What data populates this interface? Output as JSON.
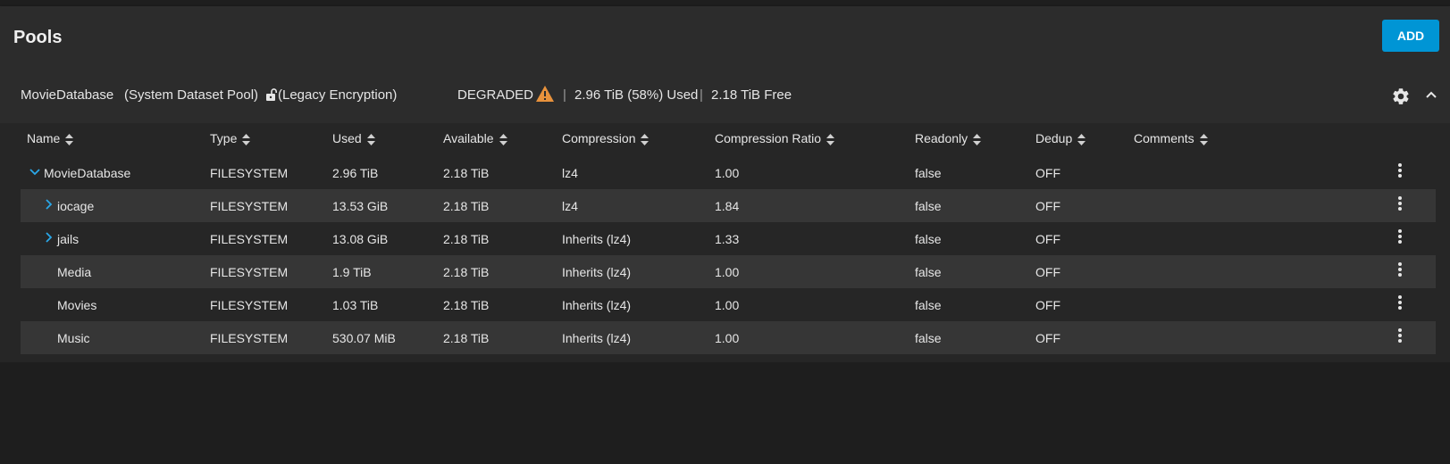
{
  "page": {
    "title": "Pools",
    "add_label": "ADD"
  },
  "pool": {
    "name": "MovieDatabase",
    "system_tag": "(System Dataset Pool)",
    "encryption": "(Legacy Encryption)",
    "status": "DEGRADED",
    "sep1": "|",
    "used": "2.96 TiB (58%) Used",
    "sep2": "|",
    "free": "2.18 TiB Free"
  },
  "columns": [
    "Name",
    "Type",
    "Used",
    "Available",
    "Compression",
    "Compression Ratio",
    "Readonly",
    "Dedup",
    "Comments"
  ],
  "rows": [
    {
      "name": "MovieDatabase",
      "type": "FILESYSTEM",
      "used": "2.96 TiB",
      "available": "2.18 TiB",
      "compression": "lz4",
      "ratio": "1.00",
      "readonly": "false",
      "dedup": "OFF",
      "comments": ""
    },
    {
      "name": "iocage",
      "type": "FILESYSTEM",
      "used": "13.53 GiB",
      "available": "2.18 TiB",
      "compression": "lz4",
      "ratio": "1.84",
      "readonly": "false",
      "dedup": "OFF",
      "comments": ""
    },
    {
      "name": "jails",
      "type": "FILESYSTEM",
      "used": "13.08 GiB",
      "available": "2.18 TiB",
      "compression": "Inherits (lz4)",
      "ratio": "1.33",
      "readonly": "false",
      "dedup": "OFF",
      "comments": ""
    },
    {
      "name": "Media",
      "type": "FILESYSTEM",
      "used": "1.9 TiB",
      "available": "2.18 TiB",
      "compression": "Inherits (lz4)",
      "ratio": "1.00",
      "readonly": "false",
      "dedup": "OFF",
      "comments": ""
    },
    {
      "name": "Movies",
      "type": "FILESYSTEM",
      "used": "1.03 TiB",
      "available": "2.18 TiB",
      "compression": "Inherits (lz4)",
      "ratio": "1.00",
      "readonly": "false",
      "dedup": "OFF",
      "comments": ""
    },
    {
      "name": "Music",
      "type": "FILESYSTEM",
      "used": "530.07 MiB",
      "available": "2.18 TiB",
      "compression": "Inherits (lz4)",
      "ratio": "1.00",
      "readonly": "false",
      "dedup": "OFF",
      "comments": ""
    }
  ],
  "colors": {
    "accent": "#0095d5",
    "warning": "#e8923c",
    "expander": "#2aa7e8"
  }
}
